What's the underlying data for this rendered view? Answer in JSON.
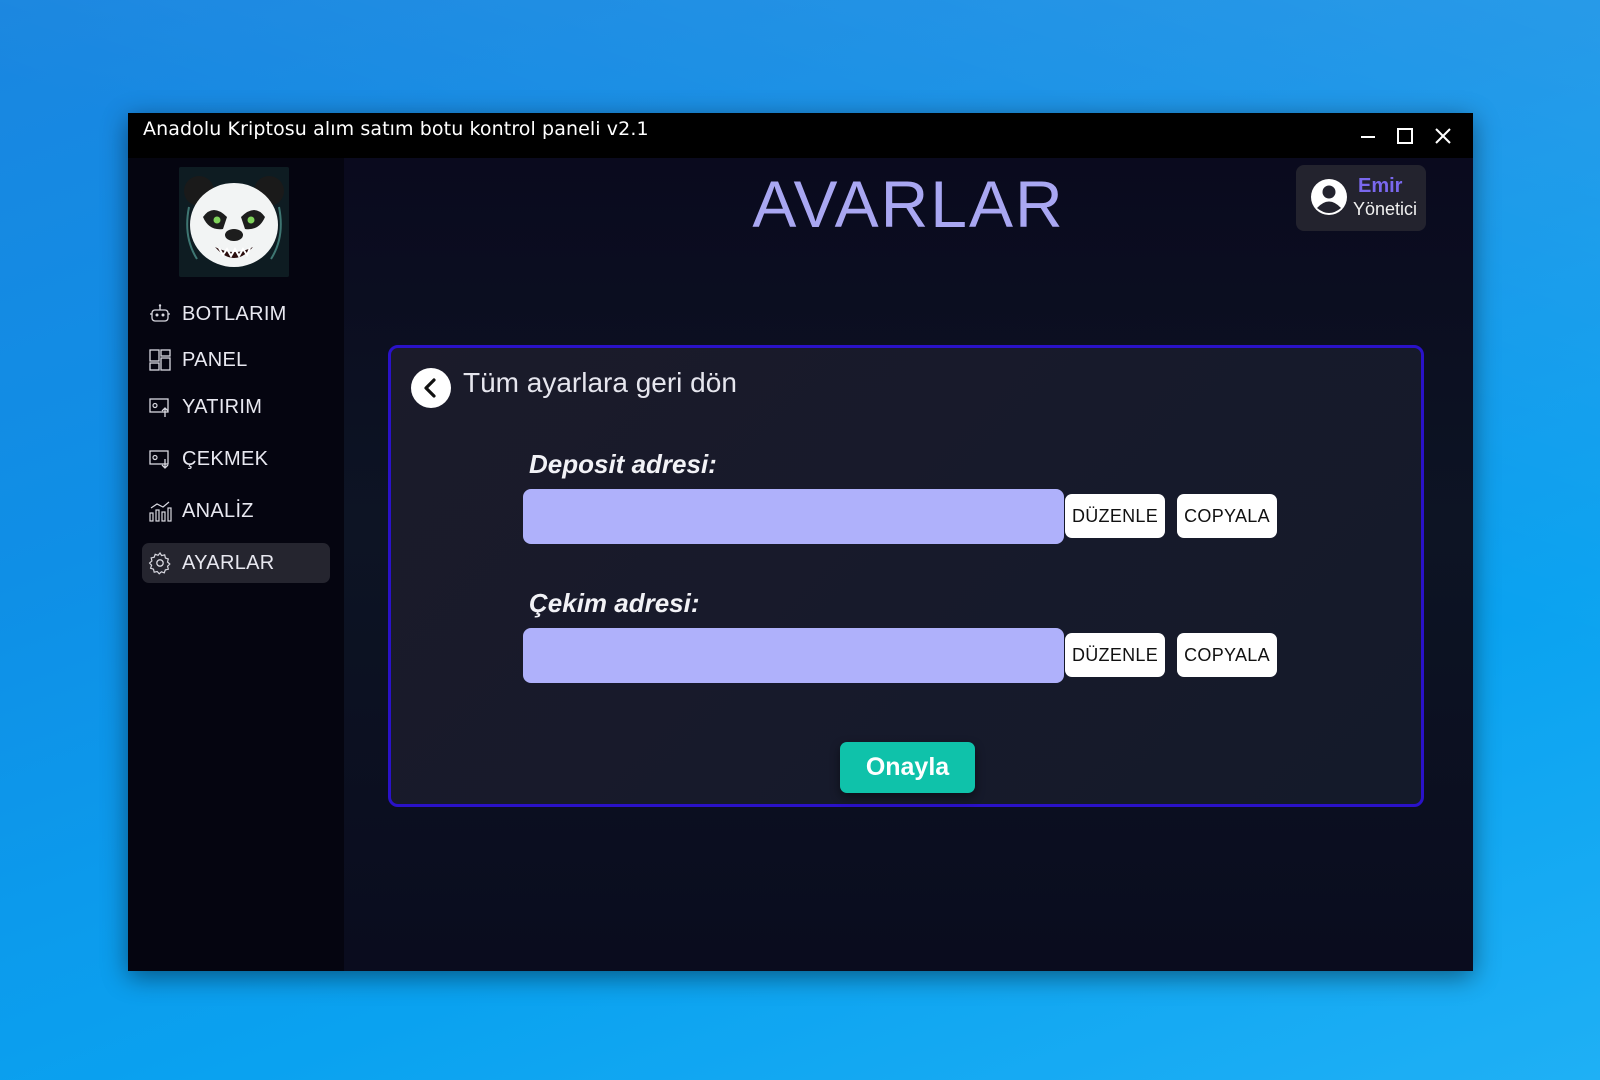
{
  "window": {
    "title": "Anadolu Kriptosu alım satım botu kontrol paneli v2.1"
  },
  "sidebar": {
    "logo_icon": "panda-logo",
    "items": [
      {
        "label": "BOTLARIM",
        "icon": "robot-icon"
      },
      {
        "label": "PANEL",
        "icon": "dashboard-icon"
      },
      {
        "label": "YATIRIM",
        "icon": "deposit-icon"
      },
      {
        "label": "ÇEKMEK",
        "icon": "withdraw-icon"
      },
      {
        "label": "ANALİZ",
        "icon": "analytics-icon"
      },
      {
        "label": "AYARLAR",
        "icon": "gear-icon",
        "active": true
      }
    ]
  },
  "header": {
    "title": "AVARLAR"
  },
  "user": {
    "name": "Emir",
    "role": "Yönetici"
  },
  "settings": {
    "back_label": "Tüm ayarlara geri dön",
    "deposit": {
      "label": "Deposit adresi:",
      "value": "",
      "edit_label": "DÜZENLE",
      "copy_label": "COPYALA"
    },
    "withdraw": {
      "label": "Çekim adresi:",
      "value": "",
      "edit_label": "DÜZENLE",
      "copy_label": "COPYALA"
    },
    "confirm_label": "Onayla"
  },
  "colors": {
    "accent_title": "#a9a7f2",
    "user_name": "#7a68ee",
    "card_border": "#2a12c8",
    "input_bg": "#afb1fb",
    "confirm_bg": "#0fc2aa"
  }
}
